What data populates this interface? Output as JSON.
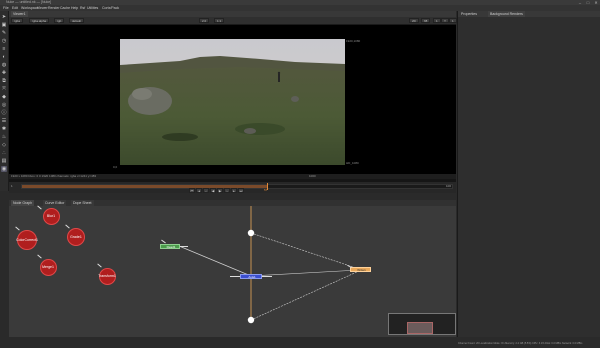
{
  "window": {
    "title": "Nuke — untitled.nk — [Nuke]",
    "buttons": [
      "–",
      "□",
      "✕"
    ]
  },
  "menubar": {
    "items": [
      "File",
      "Edit",
      "Workspace",
      "Viewer",
      "Render",
      "Cache",
      "Help",
      "Rsf",
      "Utilities",
      "Cortx/Pack"
    ]
  },
  "toolbar": {
    "icons": [
      "pointer-icon",
      "image-icon",
      "draw-icon",
      "time-icon",
      "channel-icon",
      "color-icon",
      "filter-icon",
      "keyer-icon",
      "merge-icon",
      "transform-icon",
      "3d-icon",
      "views-icon",
      "metadata-icon",
      "toolsets-icon",
      "other-icon",
      "furnace-icon",
      "ofx-icon",
      "particles-icon",
      "deep-icon",
      "cara-icon"
    ]
  },
  "viewer": {
    "tab": "Viewer1",
    "controls": [
      "rgba",
      "rgba.alpha",
      "rgb",
      "default",
      "2.0",
      "1:1",
      "2D",
      "f/8",
      "1",
      "Y",
      "1"
    ],
    "format_label": "HD_1080",
    "corner_label": "1920,1080",
    "bottom_corner": "0,0",
    "status": "1920 x 1080  bbox: 0 0 1920 1080  channels: rgba  x=1241 y=483",
    "center_status": "1000",
    "timeline": {
      "start": "1",
      "end": "100",
      "current": "57",
      "progress": 0.57
    },
    "playback_icons": [
      "first-frame-icon",
      "prev-key-icon",
      "step-back-icon",
      "play-back-icon",
      "play-icon",
      "step-forward-icon",
      "next-key-icon",
      "last-frame-icon"
    ]
  },
  "dag": {
    "tabs": [
      "Node Graph",
      "Curve Editor",
      "Dope Sheet"
    ],
    "red_nodes": [
      {
        "label": "Blur1"
      },
      {
        "label": "Grade1"
      },
      {
        "label": "ColorCorrect1"
      },
      {
        "label": "Merge1"
      },
      {
        "label": "Transform1"
      },
      {
        "label": "Roto1"
      }
    ],
    "green_node": "Read1",
    "blue_node": "Axis1",
    "orange_node": "Write1",
    "colors": {
      "red": "#b01e1e",
      "green": "#4c9c4c",
      "blue": "#3c4fd0",
      "orange": "#e9a85a",
      "background": "#3a3a3a"
    }
  },
  "properties": {
    "tabs": [
      "Properties",
      "Background Renders"
    ],
    "status": "Channel Count: 20  Localization Mode: On  Memory: 2.2 GB (5.5%)  CPU: 3.1%  Disk: 0.0 MB/s  Network: 0.0 MB/s"
  }
}
